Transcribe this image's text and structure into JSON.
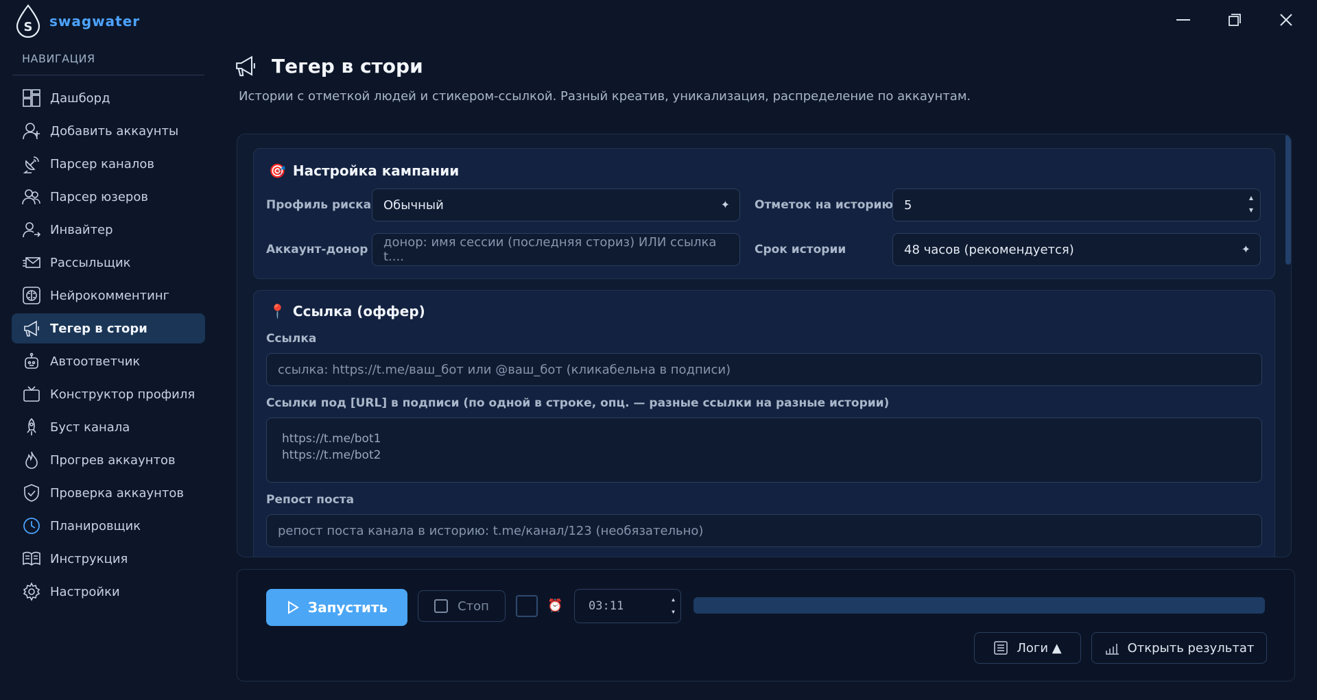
{
  "app": {
    "name": "swagwater"
  },
  "sidebar": {
    "title": "НАВИГАЦИЯ",
    "items": [
      {
        "label": "Дашборд",
        "icon": "dashboard-icon"
      },
      {
        "label": "Добавить аккаунты",
        "icon": "add-user-icon"
      },
      {
        "label": "Парсер каналов",
        "icon": "satellite-icon"
      },
      {
        "label": "Парсер юзеров",
        "icon": "users-icon"
      },
      {
        "label": "Инвайтер",
        "icon": "invite-icon"
      },
      {
        "label": "Рассыльщик",
        "icon": "envelope-icon"
      },
      {
        "label": "Нейрокомментинг",
        "icon": "brain-icon"
      },
      {
        "label": "Тегер в стори",
        "icon": "megaphone-icon",
        "active": true
      },
      {
        "label": "Автоответчик",
        "icon": "robot-icon"
      },
      {
        "label": "Конструктор профиля",
        "icon": "tv-icon"
      },
      {
        "label": "Буст канала",
        "icon": "rocket-icon"
      },
      {
        "label": "Прогрев аккаунтов",
        "icon": "flame-icon"
      },
      {
        "label": "Проверка аккаунтов",
        "icon": "shield-check-icon"
      },
      {
        "label": "Планировщик",
        "icon": "clock-icon"
      },
      {
        "label": "Инструкция",
        "icon": "book-icon"
      },
      {
        "label": "Настройки",
        "icon": "gear-icon"
      }
    ]
  },
  "page": {
    "title": "Тегер в стори",
    "subtitle": "Истории с отметкой людей и стикером-ссылкой. Разный креатив, уникализация, распределение по аккаунтам."
  },
  "campaign": {
    "title": "Настройка кампании",
    "risk_label": "Профиль риска",
    "risk_value": "Обычный",
    "tags_label": "Отметок на историю",
    "tags_value": "5",
    "donor_label": "Аккаунт-донор",
    "donor_placeholder": "донор: имя сессии (последняя сториз) ИЛИ ссылка t....",
    "term_label": "Срок истории",
    "term_value": "48 часов (рекомендуется)"
  },
  "offer": {
    "title": "Ссылка (оффер)",
    "link_label": "Ссылка",
    "link_placeholder": "ссылка: https://t.me/ваш_бот  или  @ваш_бот  (кликабельна в подписи)",
    "urls_label": "Ссылки под [URL] в подписи (по одной в строке, опц. — разные ссылки на разные истории)",
    "urls_line1": "https://t.me/bot1",
    "urls_line2": "https://t.me/bot2",
    "repost_label": "Репост поста",
    "repost_placeholder": "репост поста канала в историю: t.me/канал/123 (необязательно)"
  },
  "controls": {
    "run_label": "Запустить",
    "stop_label": "Стоп",
    "time_value": "03:11",
    "progress": 0,
    "logs_label": "Логи ▲",
    "open_result_label": "Открыть результат"
  },
  "colors": {
    "accent": "#4ba6f5",
    "brand": "#4da3ff",
    "bg": "#0c1628"
  }
}
